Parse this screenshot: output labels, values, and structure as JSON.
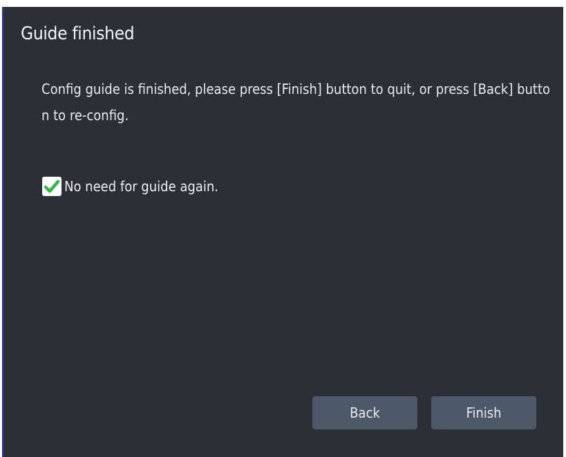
{
  "dialog": {
    "title": "Guide finished",
    "message": "Config guide is finished, please press [Finish] button to quit, or press [Back] button to re-config.",
    "checkbox": {
      "label": "No need for guide again.",
      "checked": true,
      "check_color": "#2fb84a"
    },
    "buttons": {
      "back_label": "Back",
      "finish_label": "Finish"
    }
  }
}
